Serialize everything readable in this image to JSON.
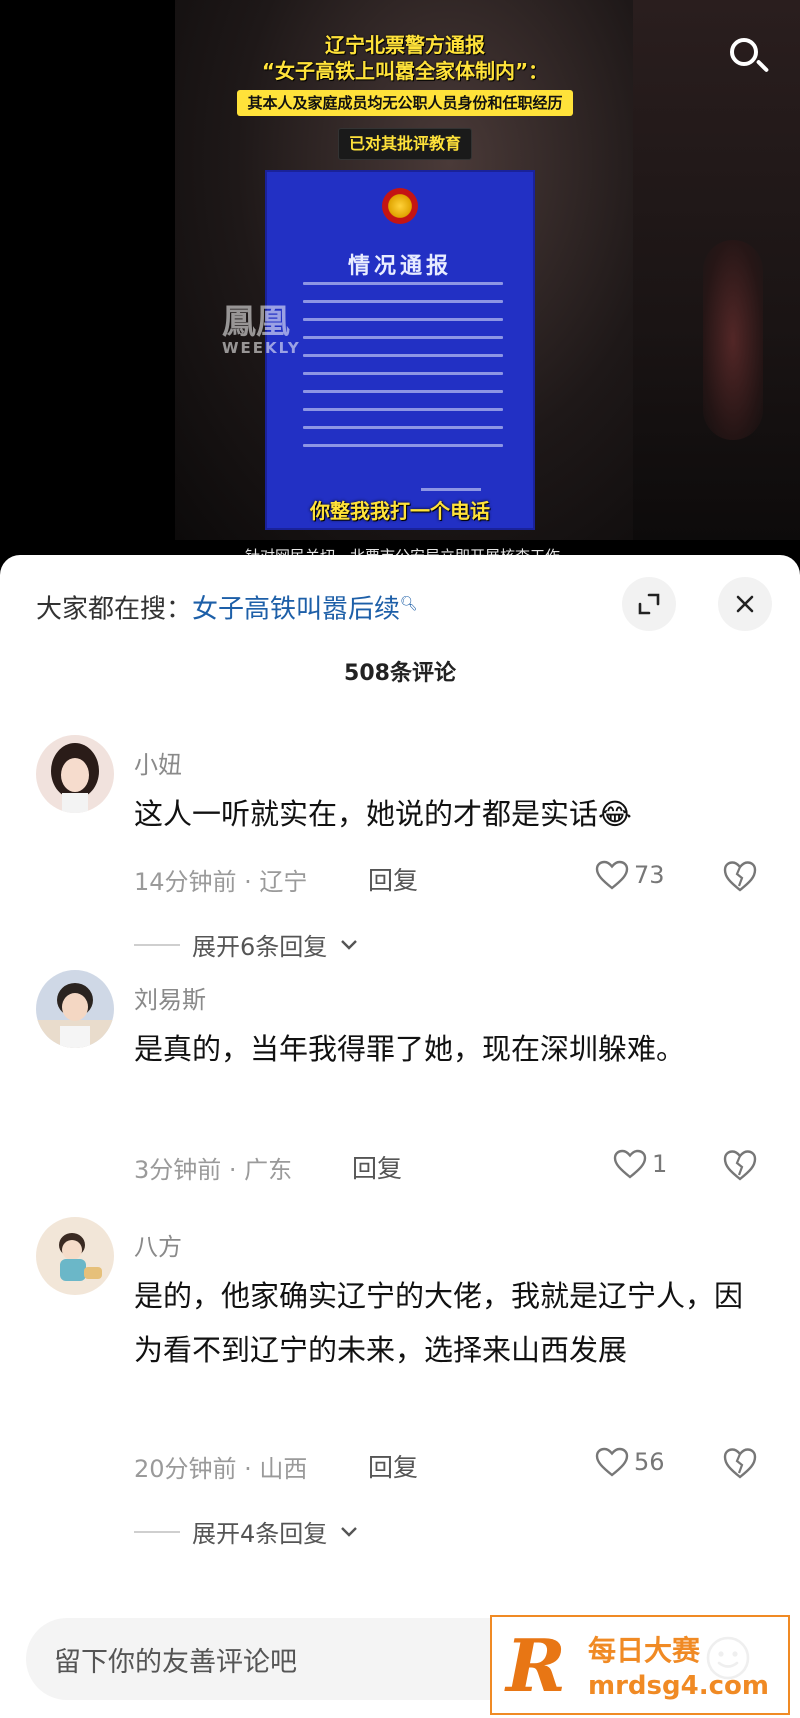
{
  "video": {
    "headline_1": "辽宁北票警方通报",
    "headline_2": "“女子高铁上叫嚣全家体制内”：",
    "headline_3": "其本人及家庭成员均无公职人员身份和任职经历",
    "headline_4": "已对其批评教育",
    "notice_title": "情况通报",
    "watermark_1": "鳳凰",
    "watermark_2": "WEEKLY",
    "subtitle": "你整我我打一个电话",
    "caption": "针对网民关切，北票市公安局立即开展核查工作"
  },
  "sheet": {
    "search_prefix": "大家都在搜：",
    "search_keyword": "女子高铁叫嚣后续",
    "comment_count": "508条评论"
  },
  "comments": [
    {
      "name": "小妞",
      "text": "这人一听就实在，她说的才都是实话😂",
      "time": "14分钟前 · 辽宁",
      "reply": "回复",
      "likes": "73",
      "expand": "展开6条回复"
    },
    {
      "name": "刘易斯",
      "text": "是真的，当年我得罪了她，现在深圳躲难。",
      "time": "3分钟前 · 广东",
      "reply": "回复",
      "likes": "1"
    },
    {
      "name": "八方",
      "text": "是的，他家确实辽宁的大佬，我就是辽宁人，因为看不到辽宁的未来，选择来山西发展",
      "time": "20分钟前 · 山西",
      "reply": "回复",
      "likes": "56",
      "expand": "展开4条回复"
    }
  ],
  "input": {
    "placeholder": "留下你的友善评论吧"
  },
  "promo": {
    "letter": "R",
    "line_1": "每日大赛",
    "line_2": "mrdsg4.com"
  },
  "colors": {
    "accent_link": "#1d5fa8",
    "notice_blue": "#2230c4",
    "caption_yellow": "#ffe23a",
    "promo_orange": "#f08a24"
  }
}
